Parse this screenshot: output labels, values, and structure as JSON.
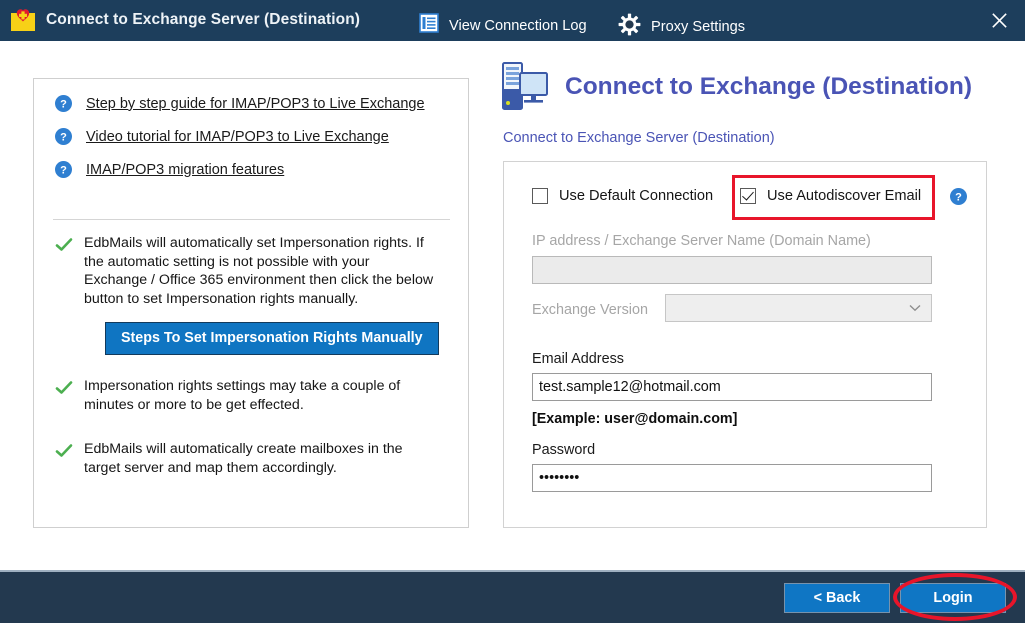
{
  "window": {
    "title": "Connect to Exchange Server (Destination)",
    "icon": "envelope-heart-icon",
    "close_label": "✕",
    "titlebar_color": "#1d3e5c",
    "footer_color": "#23394f",
    "accent_blue": "#0f76c4",
    "annotation_red": "#e8152a",
    "heading_purple": "#4a54b5"
  },
  "left_panel": {
    "links": [
      {
        "icon": "help-question-icon",
        "label": "Step by step guide for IMAP/POP3 to Live Exchange"
      },
      {
        "icon": "help-question-icon",
        "label": "Video tutorial for IMAP/POP3 to Live Exchange"
      },
      {
        "icon": "help-question-icon",
        "label": "IMAP/POP3 migration features"
      }
    ],
    "bullets": [
      {
        "icon": "green-check-icon",
        "text": "EdbMails will automatically set Impersonation rights. If the automatic setting is not possible with your Exchange / Office 365 environment then click the below button to set Impersonation rights manually."
      },
      {
        "icon": "green-check-icon",
        "text": "Impersonation rights settings may take a couple of minutes or more to be get effected."
      },
      {
        "icon": "green-check-icon",
        "text": "EdbMails will automatically create mailboxes in the target server and map them accordingly."
      }
    ],
    "steps_button": "Steps To Set Impersonation Rights Manually"
  },
  "right_panel": {
    "icon": "server-monitor-icon",
    "title": "Connect to Exchange (Destination)",
    "subtitle": "Connect to Exchange Server (Destination)",
    "checkbox_default_connection": {
      "label": "Use Default Connection",
      "checked": false
    },
    "checkbox_autodiscover": {
      "label": "Use Autodiscover Email",
      "checked": true,
      "highlighted": true
    },
    "help_icon": "help-question-icon",
    "fields": {
      "server_name": {
        "label": "IP address / Exchange Server Name (Domain Name)",
        "value": "",
        "placeholder": "",
        "disabled": true
      },
      "exchange_version": {
        "label": "Exchange Version",
        "value": "",
        "disabled": true,
        "icon": "chevron-down-icon"
      },
      "email_address": {
        "label": "Email Address",
        "value": "test.sample12@hotmail.com",
        "placeholder": "",
        "hint": "[Example: user@domain.com]",
        "disabled": false
      },
      "password": {
        "label": "Password",
        "value": "********",
        "placeholder": "",
        "disabled": false
      }
    }
  },
  "footer": {
    "view_log": {
      "icon": "log-list-icon",
      "label": "View Connection Log"
    },
    "proxy_settings": {
      "icon": "gear-icon",
      "label": "Proxy Settings"
    },
    "back_button": "< Back",
    "login_button": "Login",
    "login_highlighted": true
  }
}
